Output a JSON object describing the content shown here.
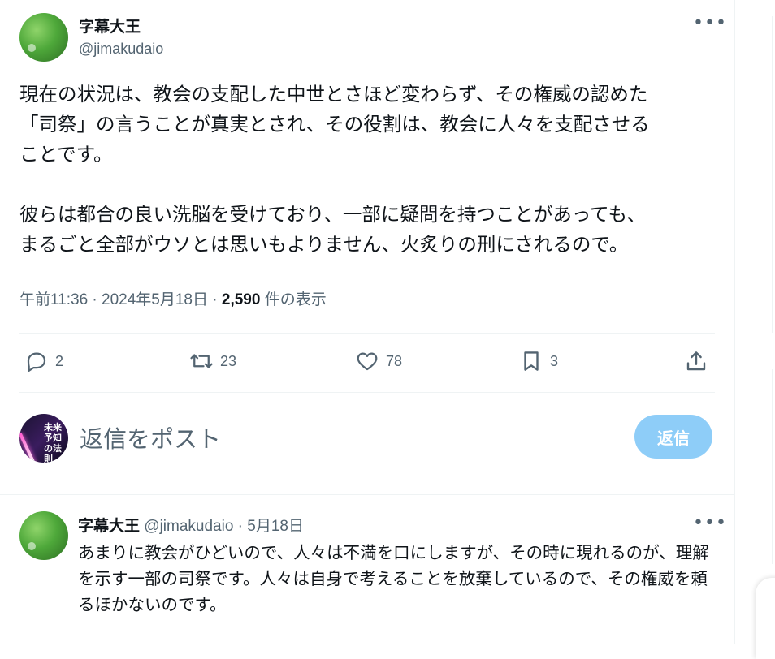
{
  "tweet": {
    "author_name": "字幕大王",
    "author_handle": "@jimakudaio",
    "text": "現在の状況は、教会の支配した中世とさほど変わらず、その権威の認めた\n「司祭」の言うことが真実とされ、その役割は、教会に人々を支配させる\nことです。\n\n彼らは都合の良い洗脳を受けており、一部に疑問を持つことがあっても、\nまるごと全部がウソとは思いもよりません、火炙りの刑にされるので。",
    "time": "午前11:36 · 2024年5月18日 · ",
    "views_count": "2,590",
    "views_label": " 件の表示",
    "more": "•••"
  },
  "actions": {
    "replies": "2",
    "retweets": "23",
    "likes": "78",
    "bookmarks": "3"
  },
  "composer": {
    "placeholder": "返信をポスト",
    "button_label": "返信",
    "avatar_text": "未来予知の法則"
  },
  "reply": {
    "author_name": "字幕大王",
    "author_handle": " @jimakudaio · 5月18日",
    "text": "あまりに教会がひどいので、人々は不満を口にしますが、その時に現れるのが、理解を示す一部の司祭です。人々は自身で考えることを放棄しているので、その権威を頼るほかないのです。",
    "more": "•••"
  },
  "colors": {
    "accent_disabled": "#8ecdf8",
    "muted_text": "#536471",
    "divider": "#eff3f4"
  }
}
